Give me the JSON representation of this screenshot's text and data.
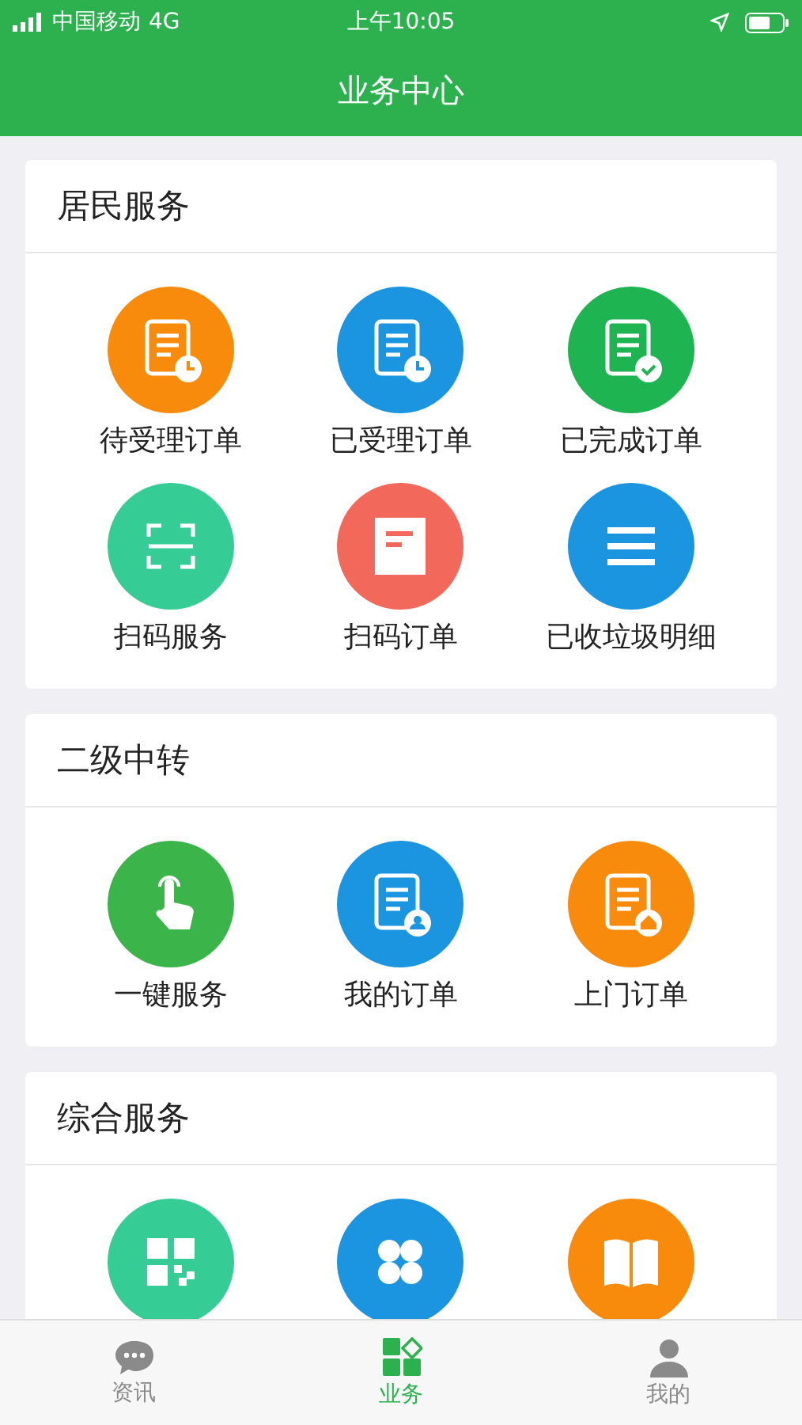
{
  "status_bar": {
    "carrier": "中国移动",
    "network": "4G",
    "time": "上午10:05"
  },
  "header": {
    "title": "业务中心"
  },
  "sections": [
    {
      "title": "居民服务",
      "items": [
        {
          "label": "待受理订单",
          "kind": "doc-clock",
          "color": "#f98b0c"
        },
        {
          "label": "已受理订单",
          "kind": "doc-clock",
          "color": "#1b95e0"
        },
        {
          "label": "已完成订单",
          "kind": "doc-check",
          "color": "#1fb452"
        },
        {
          "label": "扫码服务",
          "kind": "scan",
          "color": "#35cc95"
        },
        {
          "label": "扫码订单",
          "kind": "note",
          "color": "#f2685a"
        },
        {
          "label": "已收垃圾明细",
          "kind": "list",
          "color": "#1b95e0"
        }
      ]
    },
    {
      "title": "二级中转",
      "items": [
        {
          "label": "一键服务",
          "kind": "hand",
          "color": "#3bb54a"
        },
        {
          "label": "我的订单",
          "kind": "doc-user",
          "color": "#1b95e0"
        },
        {
          "label": "上门订单",
          "kind": "doc-home",
          "color": "#f98b0c"
        }
      ]
    },
    {
      "title": "综合服务",
      "items": [
        {
          "kind": "qr",
          "color": "#35cc95"
        },
        {
          "kind": "clover",
          "color": "#1b95e0"
        },
        {
          "kind": "book",
          "color": "#f98b0c"
        }
      ]
    }
  ],
  "tab_bar": [
    {
      "label": "资讯",
      "kind": "chat",
      "selected": false
    },
    {
      "label": "业务",
      "kind": "grid",
      "selected": true
    },
    {
      "label": "我的",
      "kind": "person",
      "selected": false
    }
  ]
}
